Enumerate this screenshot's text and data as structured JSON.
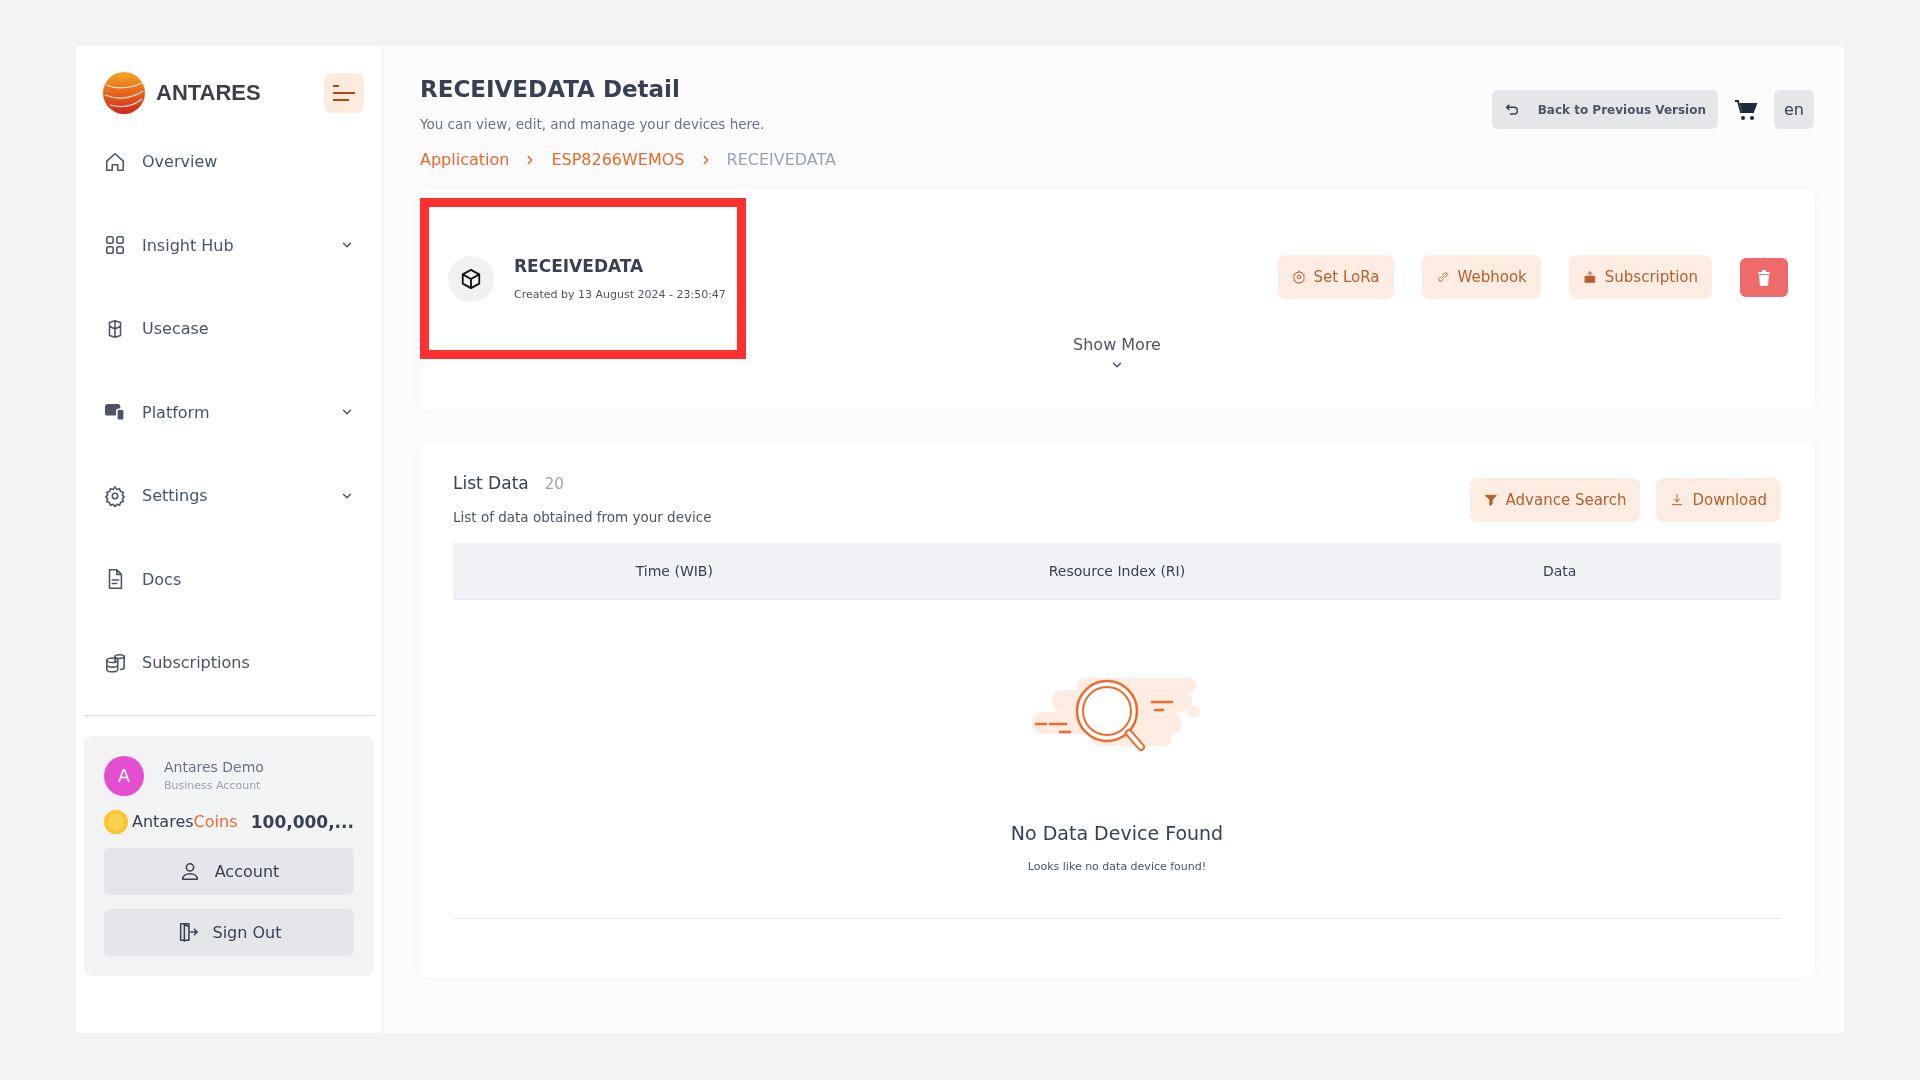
{
  "sidebar": {
    "brand": "ANTARES",
    "items": [
      {
        "label": "Overview",
        "kind": "home",
        "expandable": false
      },
      {
        "label": "Insight Hub",
        "kind": "grid",
        "expandable": true
      },
      {
        "label": "Usecase",
        "kind": "cube",
        "expandable": false
      },
      {
        "label": "Platform",
        "kind": "devices",
        "expandable": true
      },
      {
        "label": "Settings",
        "kind": "gear",
        "expandable": true
      },
      {
        "label": "Docs",
        "kind": "doc",
        "expandable": false
      },
      {
        "label": "Subscriptions",
        "kind": "coins",
        "expandable": false
      }
    ],
    "user": {
      "initial": "A",
      "name": "Antares Demo",
      "role": "Business Account",
      "coins_label": "Antares",
      "coins_accent": "Coins",
      "balance": "100,000,..."
    },
    "buttons": [
      {
        "label": "Account",
        "kind": "user"
      },
      {
        "label": "Sign Out",
        "kind": "signout"
      }
    ]
  },
  "header": {
    "title": "RECEIVEDATA Detail",
    "subtitle": "You can view, edit, and manage your devices here.",
    "back_button": "Back to Previous Version",
    "language": "en"
  },
  "breadcrumb": [
    {
      "label": "Application",
      "current": false
    },
    {
      "label": "ESP8266WEMOS",
      "current": false
    },
    {
      "label": "RECEIVEDATA",
      "current": true
    }
  ],
  "device": {
    "name": "RECEIVEDATA",
    "created": "Created by 13 August 2024 - 23:50:47",
    "highlighted": true,
    "show_more": "Show More",
    "actions": [
      {
        "label": "Set LoRa",
        "kind": "gear"
      },
      {
        "label": "Webhook",
        "kind": "link"
      },
      {
        "label": "Subscription",
        "kind": "box"
      }
    ]
  },
  "list": {
    "title": "List Data",
    "count": "20",
    "subtitle": "List of data obtained from your device",
    "actions": [
      {
        "label": "Advance Search",
        "kind": "filter"
      },
      {
        "label": "Download",
        "kind": "download"
      }
    ],
    "columns": [
      "Time (WIB)",
      "Resource Index (RI)",
      "Data"
    ],
    "empty_title": "No Data Device Found",
    "empty_text": "Looks like no data device found!"
  }
}
